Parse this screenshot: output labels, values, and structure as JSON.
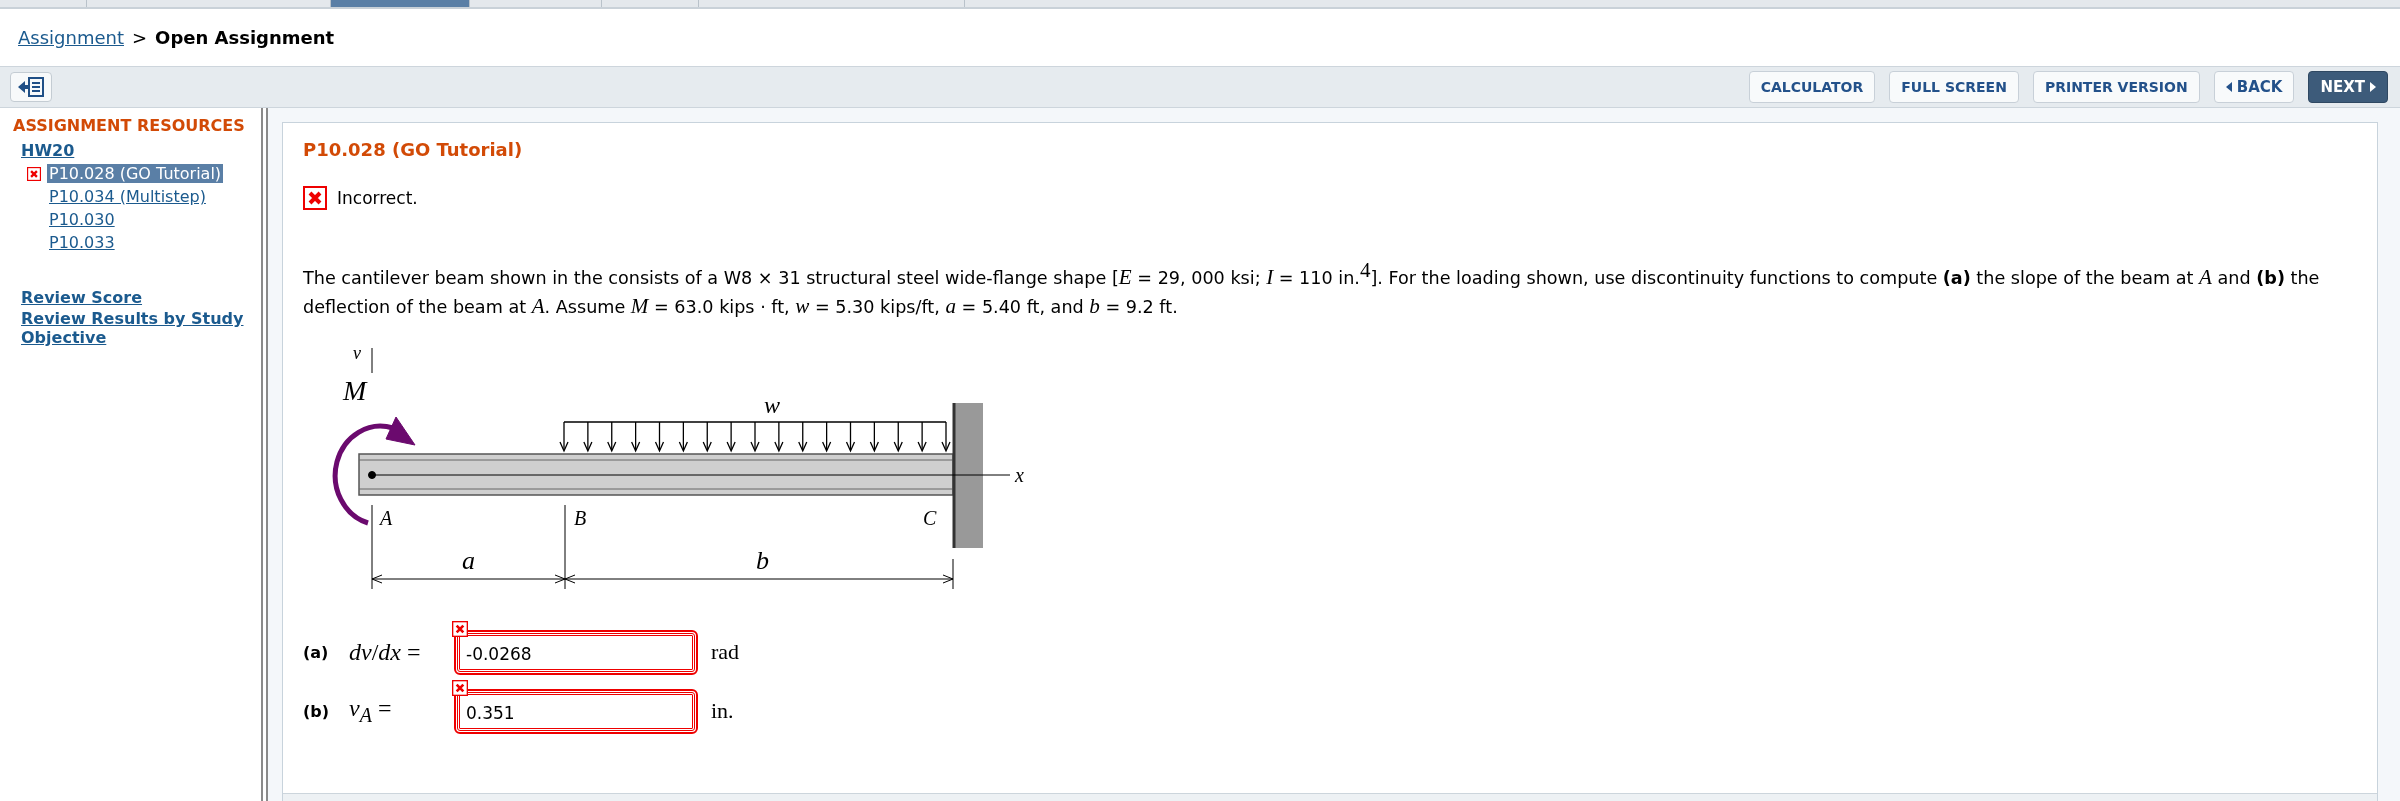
{
  "top_tabs": [
    {
      "selected": false
    },
    {
      "selected": false
    },
    {
      "selected": true
    },
    {
      "selected": false
    },
    {
      "selected": false
    },
    {
      "selected": false
    }
  ],
  "breadcrumb": {
    "link": "Assignment",
    "separator": ">",
    "current": "Open Assignment"
  },
  "toolbar": {
    "buttons": [
      {
        "label": "CALCULATOR",
        "kind": "default"
      },
      {
        "label": "FULL SCREEN",
        "kind": "default"
      },
      {
        "label": "PRINTER VERSION",
        "kind": "default"
      },
      {
        "label": "BACK",
        "kind": "back"
      },
      {
        "label": "NEXT",
        "kind": "next"
      }
    ]
  },
  "sidebar": {
    "title": "ASSIGNMENT RESOURCES",
    "assignment": "HW20",
    "items": [
      {
        "label": "P10.028 (GO Tutorial)",
        "selected": true,
        "incorrect": true
      },
      {
        "label": "P10.034 (Multistep)",
        "selected": false,
        "incorrect": false
      },
      {
        "label": "P10.030",
        "selected": false,
        "incorrect": false
      },
      {
        "label": "P10.033",
        "selected": false,
        "incorrect": false
      }
    ],
    "links": [
      "Review Score",
      "Review Results by Study Objective"
    ]
  },
  "problem": {
    "title": "P10.028 (GO Tutorial)",
    "feedback": {
      "incorrect": true,
      "text": "Incorrect."
    },
    "statement": "The cantilever beam shown in the consists of a W8 × 31 structural steel wide-flange shape [*E* = 29, 000 ksi; *I* = 110 in.$^{4}$]. For the loading shown, use discontinuity functions to compute **(a)** the slope of the beam at *A* and **(b)** the deflection of the beam at *A*. Assume *M* = 63.0 kips · ft, *w* = 5.30 kips/ft, *a* = 5.40 ft, and *b* = 9.2 ft.",
    "diagram": {
      "v_axis": "v",
      "moment": "M",
      "load": "w",
      "x_axis": "x",
      "point_a": "A",
      "point_b": "B",
      "point_c": "C",
      "span_a": "a",
      "span_b": "b"
    },
    "answers": [
      {
        "part": "(a)",
        "quantity": "*dv*/*dx* =",
        "value": "-0.0268",
        "unit": "rad",
        "incorrect": true
      },
      {
        "part": "(b)",
        "quantity": "*v$_{A}$* =",
        "value": "0.351",
        "unit": "in.",
        "incorrect": true
      }
    ]
  }
}
